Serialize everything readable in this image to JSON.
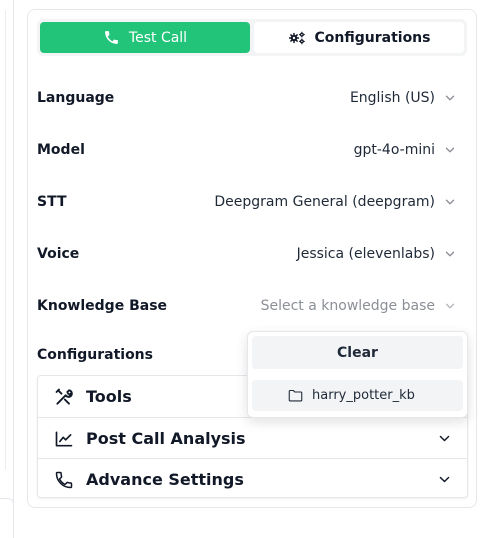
{
  "tabs": {
    "test_call": "Test Call",
    "configurations": "Configurations"
  },
  "settings": [
    {
      "label": "Language",
      "value": "English (US)",
      "is_placeholder": false
    },
    {
      "label": "Model",
      "value": "gpt-4o-mini",
      "is_placeholder": false
    },
    {
      "label": "STT",
      "value": "Deepgram General (deepgram)",
      "is_placeholder": false
    },
    {
      "label": "Voice",
      "value": "Jessica (elevenlabs)",
      "is_placeholder": false
    },
    {
      "label": "Knowledge Base",
      "value": "Select a knowledge base",
      "is_placeholder": true
    }
  ],
  "configurations_label": "Configurations",
  "accordion": {
    "tools": "Tools",
    "post_call_analysis": "Post Call Analysis",
    "advance_settings": "Advance Settings"
  },
  "dropdown": {
    "clear_label": "Clear",
    "items": [
      "harry_potter_kb"
    ]
  },
  "colors": {
    "accent": "#22c47a",
    "muted": "#8b8f96"
  },
  "icons": {
    "test_call": "phone-icon",
    "configurations": "gears-icon",
    "tools": "tools-icon",
    "post_call_analysis": "chart-line-icon",
    "advance_settings": "phone-outline-icon",
    "knowledge_item": "folder-icon"
  }
}
